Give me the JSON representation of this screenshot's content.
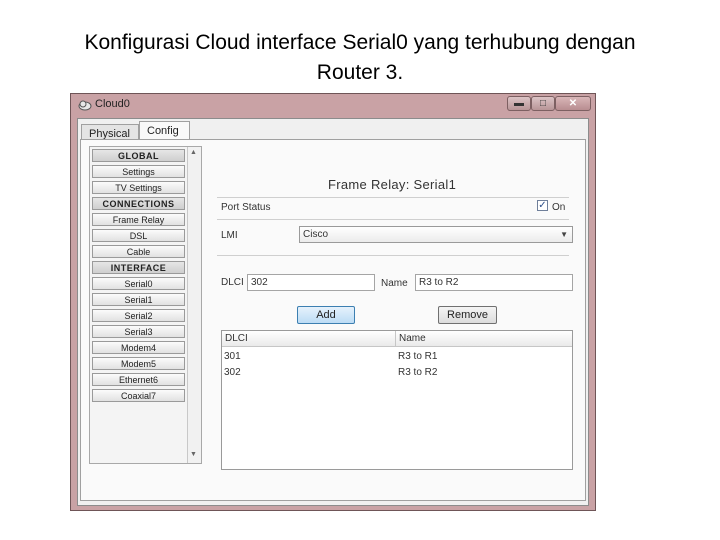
{
  "slide": {
    "title_line1": "Konfigurasi Cloud interface Serial0 yang terhubung dengan",
    "title_line2": "Router 3."
  },
  "window": {
    "title": "Cloud0",
    "min_label": "▬",
    "max_label": "□",
    "close_label": "✕"
  },
  "tabs": [
    {
      "label": "Physical"
    },
    {
      "label": "Config"
    }
  ],
  "sidebar": {
    "items": [
      {
        "label": "GLOBAL"
      },
      {
        "label": "Settings"
      },
      {
        "label": "TV Settings"
      },
      {
        "label": "CONNECTIONS"
      },
      {
        "label": "Frame Relay"
      },
      {
        "label": "DSL"
      },
      {
        "label": "Cable"
      },
      {
        "label": "INTERFACE"
      },
      {
        "label": "Serial0"
      },
      {
        "label": "Serial1"
      },
      {
        "label": "Serial2"
      },
      {
        "label": "Serial3"
      },
      {
        "label": "Modem4"
      },
      {
        "label": "Modem5"
      },
      {
        "label": "Ethernet6"
      },
      {
        "label": "Coaxial7"
      }
    ]
  },
  "panel": {
    "title": "Frame Relay: Serial1",
    "port_status_label": "Port Status",
    "port_status_on_label": "On",
    "port_status_checked": true,
    "lmi_label": "LMI",
    "lmi_value": "Cisco",
    "dlci_label": "DLCI",
    "dlci_value": "302",
    "name_label": "Name",
    "name_value": "R3 to R2",
    "add_label": "Add",
    "remove_label": "Remove"
  },
  "table": {
    "headers": [
      "DLCI",
      "Name"
    ],
    "rows": [
      [
        "301",
        "R3 to R1"
      ],
      [
        "302",
        "R3 to R2"
      ]
    ]
  }
}
